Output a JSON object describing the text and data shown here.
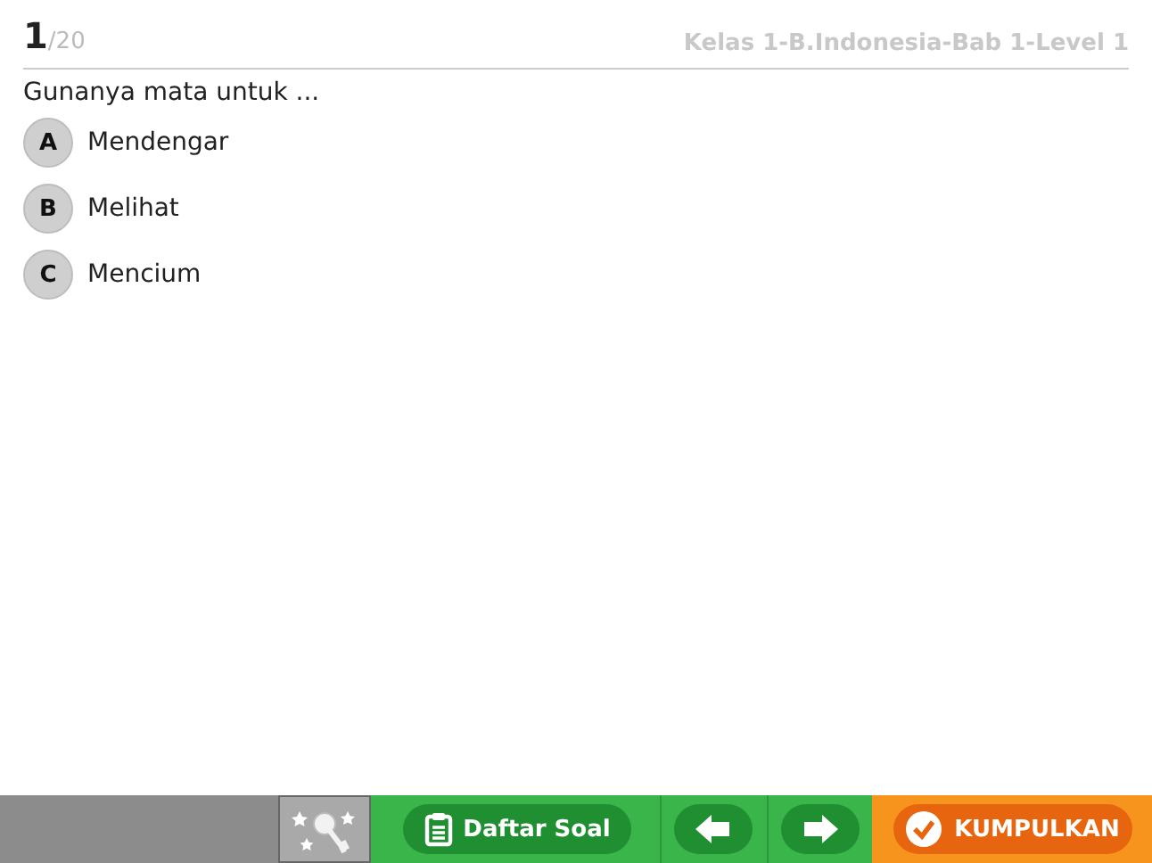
{
  "header": {
    "number": "1",
    "total": "/20",
    "title": "Kelas 1-B.Indonesia-Bab 1-Level 1"
  },
  "question": "Gunanya mata untuk ...",
  "options": [
    {
      "letter": "A",
      "text": "Mendengar",
      "selected": false
    },
    {
      "letter": "B",
      "text": "Melihat",
      "selected": false
    },
    {
      "letter": "C",
      "text": "Mencium",
      "selected": false
    }
  ],
  "toolbar": {
    "list_button": "Daftar Soal",
    "submit_button": "KUMPULKAN"
  }
}
